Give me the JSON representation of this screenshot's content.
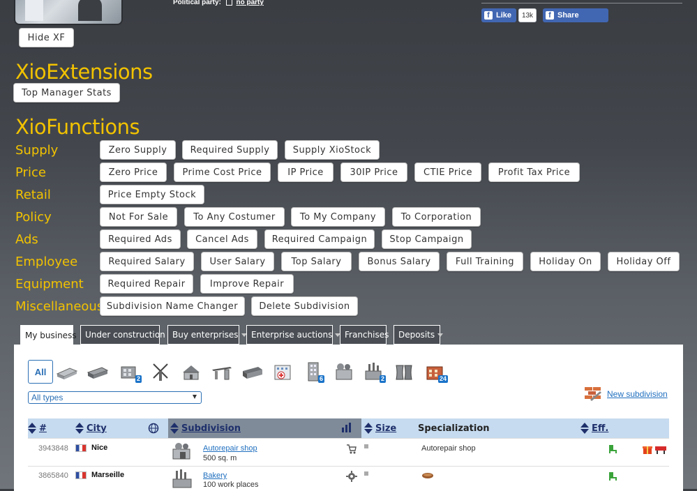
{
  "header": {
    "political_label": "Political party:",
    "political_value": "no party",
    "hide_button": "Hide XF",
    "fb_like": "Like",
    "fb_count": "13k",
    "fb_share": "Share"
  },
  "xioextensions": {
    "title": "XioExtensions",
    "top_manager_button": "Top Manager Stats"
  },
  "xiofunctions": {
    "title": "XioFunctions",
    "groups": [
      {
        "label": "Supply",
        "buttons": [
          "Zero Supply",
          "Required Supply",
          "Supply XioStock"
        ]
      },
      {
        "label": "Price",
        "buttons": [
          "Zero Price",
          "Prime Cost Price",
          "IP Price",
          "30IP Price",
          "CTIE Price",
          "Profit Tax Price"
        ]
      },
      {
        "label": "Retail",
        "buttons": [
          "Price Empty Stock"
        ]
      },
      {
        "label": "Policy",
        "buttons": [
          "Not For Sale",
          "To Any Costumer",
          "To My Company",
          "To Corporation"
        ]
      },
      {
        "label": "Ads",
        "buttons": [
          "Required Ads",
          "Cancel Ads",
          "Required Campaign",
          "Stop Campaign"
        ]
      },
      {
        "label": "Employee",
        "buttons": [
          "Required Salary",
          "User Salary",
          "Top Salary",
          "Bonus Salary",
          "Full Training",
          "Holiday On",
          "Holiday Off"
        ]
      },
      {
        "label": "Equipment",
        "buttons": [
          "Required Repair",
          "Improve Repair"
        ]
      },
      {
        "label": "Miscellaneous",
        "buttons": [
          "Subdivision Name Changer",
          "Delete Subdivision"
        ]
      }
    ]
  },
  "tabs": [
    "My business",
    "Under construction",
    "Buy enterprises",
    "Enterprise auctions",
    "Franchises",
    "Deposits"
  ],
  "filters": {
    "all_label": "All",
    "badges": {
      "office": "2",
      "tower": "6",
      "factory": "2",
      "shop": "24"
    },
    "type_select": "All types",
    "new_subdivision": "New subdivision"
  },
  "table": {
    "headers": {
      "id": "#",
      "city": "City",
      "subdivision": "Subdivision",
      "size": "Size",
      "specialization": "Specialization",
      "eff": "Eff."
    },
    "rows": [
      {
        "id": "3943848",
        "city": "Nice",
        "subdivision": "Autorepair shop",
        "size": "500 sq. m",
        "specialization": "Autorepair shop"
      },
      {
        "id": "3865840",
        "city": "Marseille",
        "subdivision": "Bakery",
        "size": "100 work places",
        "specialization": ""
      }
    ]
  },
  "colors": {
    "accent_yellow": "#f2c200",
    "link_blue": "#1f6fbf",
    "fb_blue": "#4267b2"
  }
}
